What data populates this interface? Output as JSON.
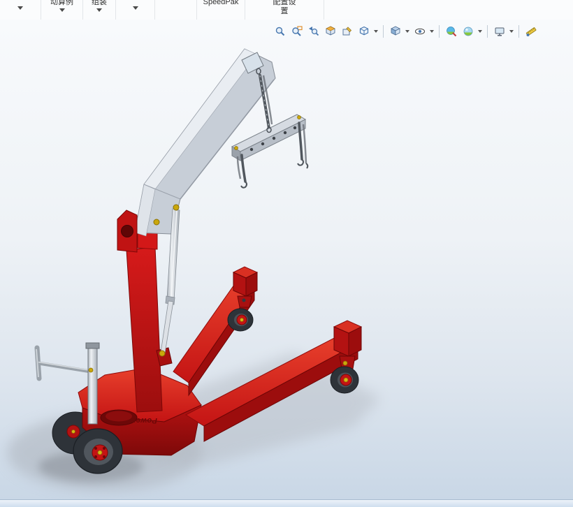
{
  "top_toolbar": {
    "items": [
      {
        "label": "动算例"
      },
      {
        "label": "组装"
      },
      {
        "label": "SpeedPak"
      },
      {
        "label": "配置设置"
      }
    ]
  },
  "headsup_toolbar": {
    "icons": [
      {
        "name": "zoom-to-fit"
      },
      {
        "name": "zoom-to-area"
      },
      {
        "name": "previous-view"
      },
      {
        "name": "section-view"
      },
      {
        "name": "3d-drawing-view"
      },
      {
        "name": "view-orientation",
        "has_dropdown": true
      },
      {
        "name": "display-style",
        "has_dropdown": true
      },
      {
        "name": "hide-show-items",
        "has_dropdown": true
      },
      {
        "name": "edit-appearance"
      },
      {
        "name": "apply-scene",
        "has_dropdown": true
      },
      {
        "name": "view-settings",
        "has_dropdown": true
      },
      {
        "name": "measure"
      }
    ]
  },
  "viewport": {
    "logo_text": "Power"
  },
  "colors": {
    "crane_red": "#c41414",
    "crane_red_light": "#e8402c",
    "boom_gray": "#c7ced7",
    "fitting_yellow": "#caa70c",
    "chain_gray": "#51575e",
    "background_top": "#f8fafc",
    "background_bottom": "#c9d7e6"
  }
}
